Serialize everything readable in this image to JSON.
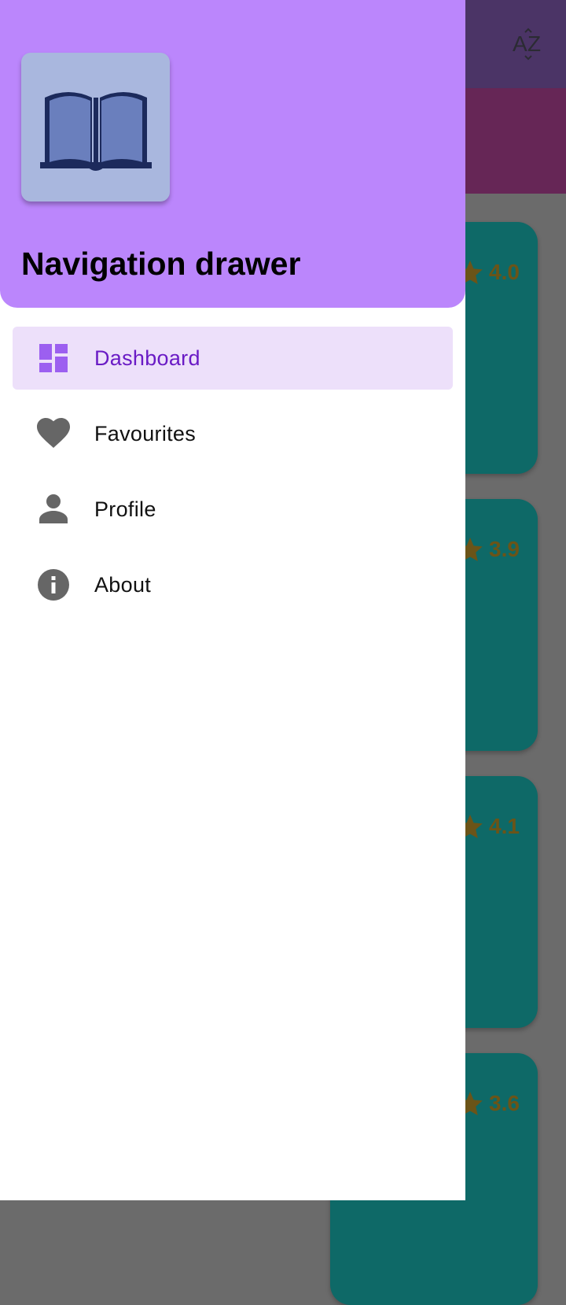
{
  "app_background": {
    "sort_icon": "sort-az-icon",
    "ratings": [
      "4.0",
      "3.9",
      "4.1",
      "3.6"
    ],
    "colors": {
      "toolbar": "#4b3466",
      "banner": "#662656",
      "card": "#0e6967",
      "scrim": "#6b6b6b"
    }
  },
  "drawer": {
    "header": {
      "logo_icon": "open-book-icon",
      "title": "Navigation drawer",
      "background": "#bb86fc"
    },
    "items": [
      {
        "label": "Dashboard",
        "icon": "dashboard-icon",
        "selected": true
      },
      {
        "label": "Favourites",
        "icon": "heart-icon",
        "selected": false
      },
      {
        "label": "Profile",
        "icon": "person-icon",
        "selected": false
      },
      {
        "label": "About",
        "icon": "info-icon",
        "selected": false
      }
    ],
    "colors": {
      "selected_bg": "#ede0fa",
      "selected_text": "#6a1bc5",
      "icon_gray": "#666666",
      "icon_selected": "#9c5ff0"
    }
  }
}
